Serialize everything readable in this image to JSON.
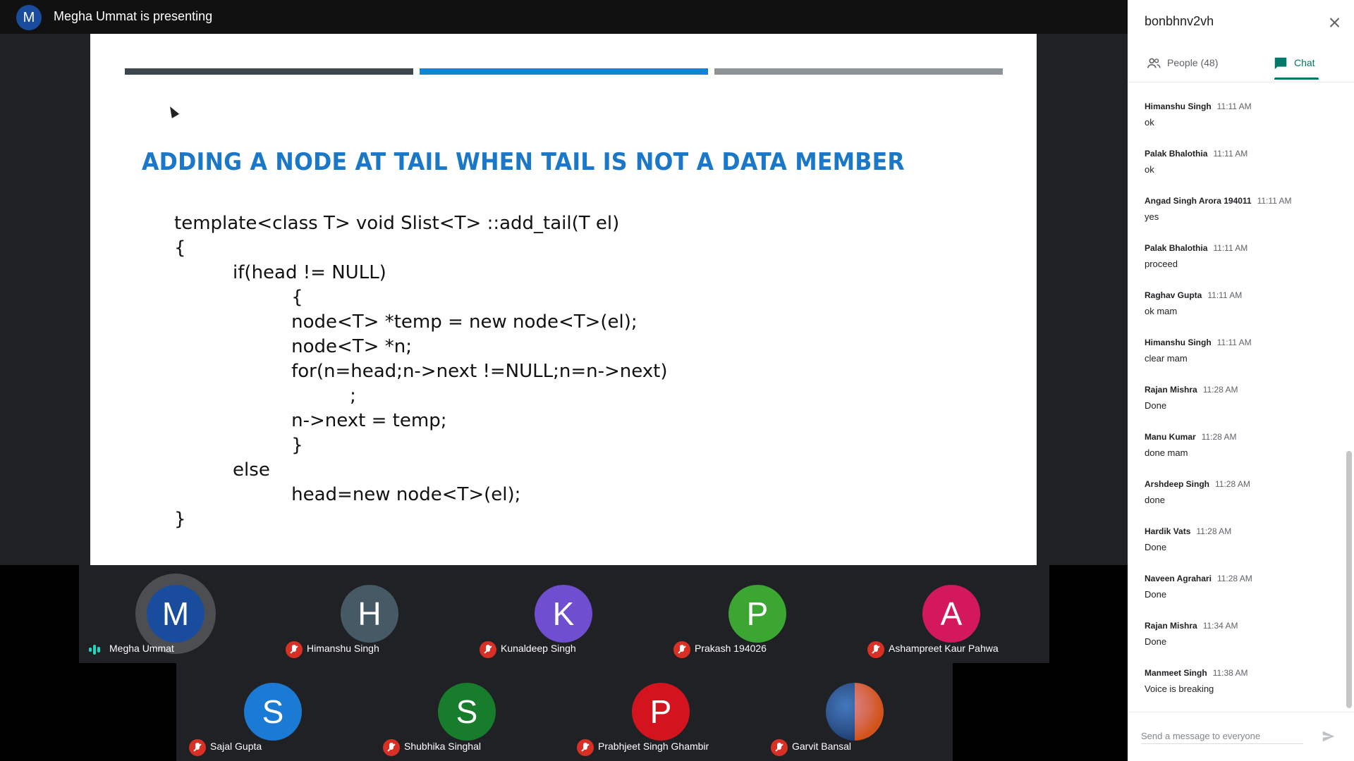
{
  "topbar": {
    "presenter_initial": "M",
    "presenting_text": "Megha Ummat is presenting"
  },
  "slide": {
    "title": "ADDING A NODE AT TAIL WHEN TAIL IS NOT A DATA MEMBER",
    "code_lines": [
      "template<class T> void Slist<T> ::add_tail(T el)",
      "{",
      "    if(head != NULL)",
      "        {",
      "        node<T> *temp = new node<T>(el);",
      "        node<T> *n;",
      "        for(n=head;n->next !=NULL;n=n->next)",
      "            ;",
      "        n->next = temp;",
      "        }",
      "    else",
      "        head=new node<T>(el);",
      "}"
    ],
    "colors": {
      "title": "#1b78c9",
      "bar_dark": "#3d464d",
      "bar_blue": "#0f85d4",
      "bar_grey": "#8e9397"
    }
  },
  "participants": [
    {
      "initial": "M",
      "name": "Megha Ummat",
      "color": "#1a4c9e",
      "speaking": true,
      "muted": false
    },
    {
      "initial": "H",
      "name": "Himanshu Singh",
      "color": "#455a64",
      "speaking": false,
      "muted": true
    },
    {
      "initial": "K",
      "name": "Kunaldeep Singh",
      "color": "#6f4fcf",
      "speaking": false,
      "muted": true
    },
    {
      "initial": "P",
      "name": "Prakash 194026",
      "color": "#3ba632",
      "speaking": false,
      "muted": true
    },
    {
      "initial": "A",
      "name": "Ashampreet Kaur Pahwa",
      "color": "#d3185e",
      "speaking": false,
      "muted": true
    },
    {
      "initial": "S",
      "name": "Sajal Gupta",
      "color": "#1b7ad3",
      "speaking": false,
      "muted": true
    },
    {
      "initial": "S",
      "name": "Shubhika Singhal",
      "color": "#177d2c",
      "speaking": false,
      "muted": true
    },
    {
      "initial": "P",
      "name": "Prabhjeet Singh Ghambir",
      "color": "#d3141f",
      "speaking": false,
      "muted": true
    },
    {
      "initial": "",
      "name": "Garvit Bansal",
      "color": "#1e3c6e",
      "speaking": false,
      "muted": true,
      "photo": true
    }
  ],
  "panel": {
    "meeting_code": "bonbhnv2vh",
    "tabs": {
      "people": "People (48)",
      "chat": "Chat"
    },
    "active_tab": "chat",
    "input_placeholder": "Send a message to everyone",
    "messages": [
      {
        "sender": "Himanshu Singh",
        "time": "11:11 AM",
        "text": "ok"
      },
      {
        "sender": "Palak Bhalothia",
        "time": "11:11 AM",
        "text": "ok"
      },
      {
        "sender": "Angad Singh Arora 194011",
        "time": "11:11 AM",
        "text": "yes"
      },
      {
        "sender": "Palak Bhalothia",
        "time": "11:11 AM",
        "text": "proceed"
      },
      {
        "sender": "Raghav Gupta",
        "time": "11:11 AM",
        "text": "ok mam"
      },
      {
        "sender": "Himanshu Singh",
        "time": "11:11 AM",
        "text": "clear mam"
      },
      {
        "sender": "Rajan Mishra",
        "time": "11:28 AM",
        "text": "Done"
      },
      {
        "sender": "Manu Kumar",
        "time": "11:28 AM",
        "text": "done mam"
      },
      {
        "sender": "Arshdeep Singh",
        "time": "11:28 AM",
        "text": "done"
      },
      {
        "sender": "Hardik Vats",
        "time": "11:28 AM",
        "text": "Done"
      },
      {
        "sender": "Naveen Agrahari",
        "time": "11:28 AM",
        "text": "Done"
      },
      {
        "sender": "Rajan Mishra",
        "time": "11:34 AM",
        "text": "Done"
      },
      {
        "sender": "Manmeet Singh",
        "time": "11:38 AM",
        "text": "Voice is breaking"
      }
    ],
    "colors": {
      "accent": "#00796b",
      "muted_mic": "#d93025"
    }
  }
}
